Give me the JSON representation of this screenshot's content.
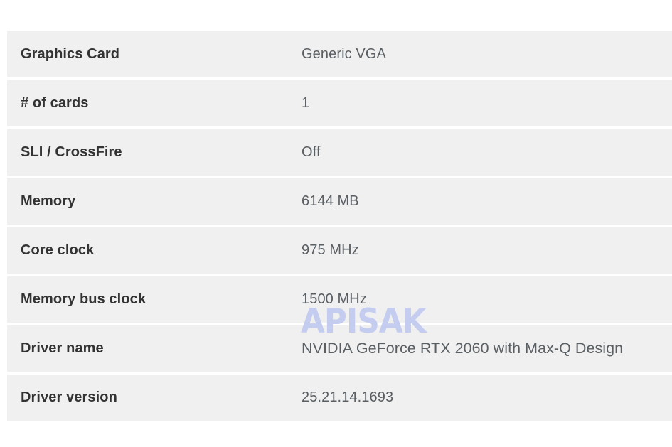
{
  "watermark": {
    "text": "APISAK",
    "color": "#c4cdef"
  },
  "theme": {
    "row_background": "#f0f0f0",
    "page_background": "#ffffff",
    "label_color": "#333333",
    "value_color": "#5a5f63"
  },
  "spec_table": {
    "rows": [
      {
        "label": "Graphics Card",
        "value": "Generic VGA"
      },
      {
        "label": "# of cards",
        "value": "1"
      },
      {
        "label": "SLI / CrossFire",
        "value": "Off"
      },
      {
        "label": "Memory",
        "value": "6144 MB"
      },
      {
        "label": "Core clock",
        "value": "975 MHz"
      },
      {
        "label": "Memory bus clock",
        "value": "1500 MHz"
      },
      {
        "label": "Driver name",
        "value": "NVIDIA GeForce RTX 2060 with Max-Q Design"
      },
      {
        "label": "Driver version",
        "value": "25.21.14.1693"
      }
    ]
  }
}
